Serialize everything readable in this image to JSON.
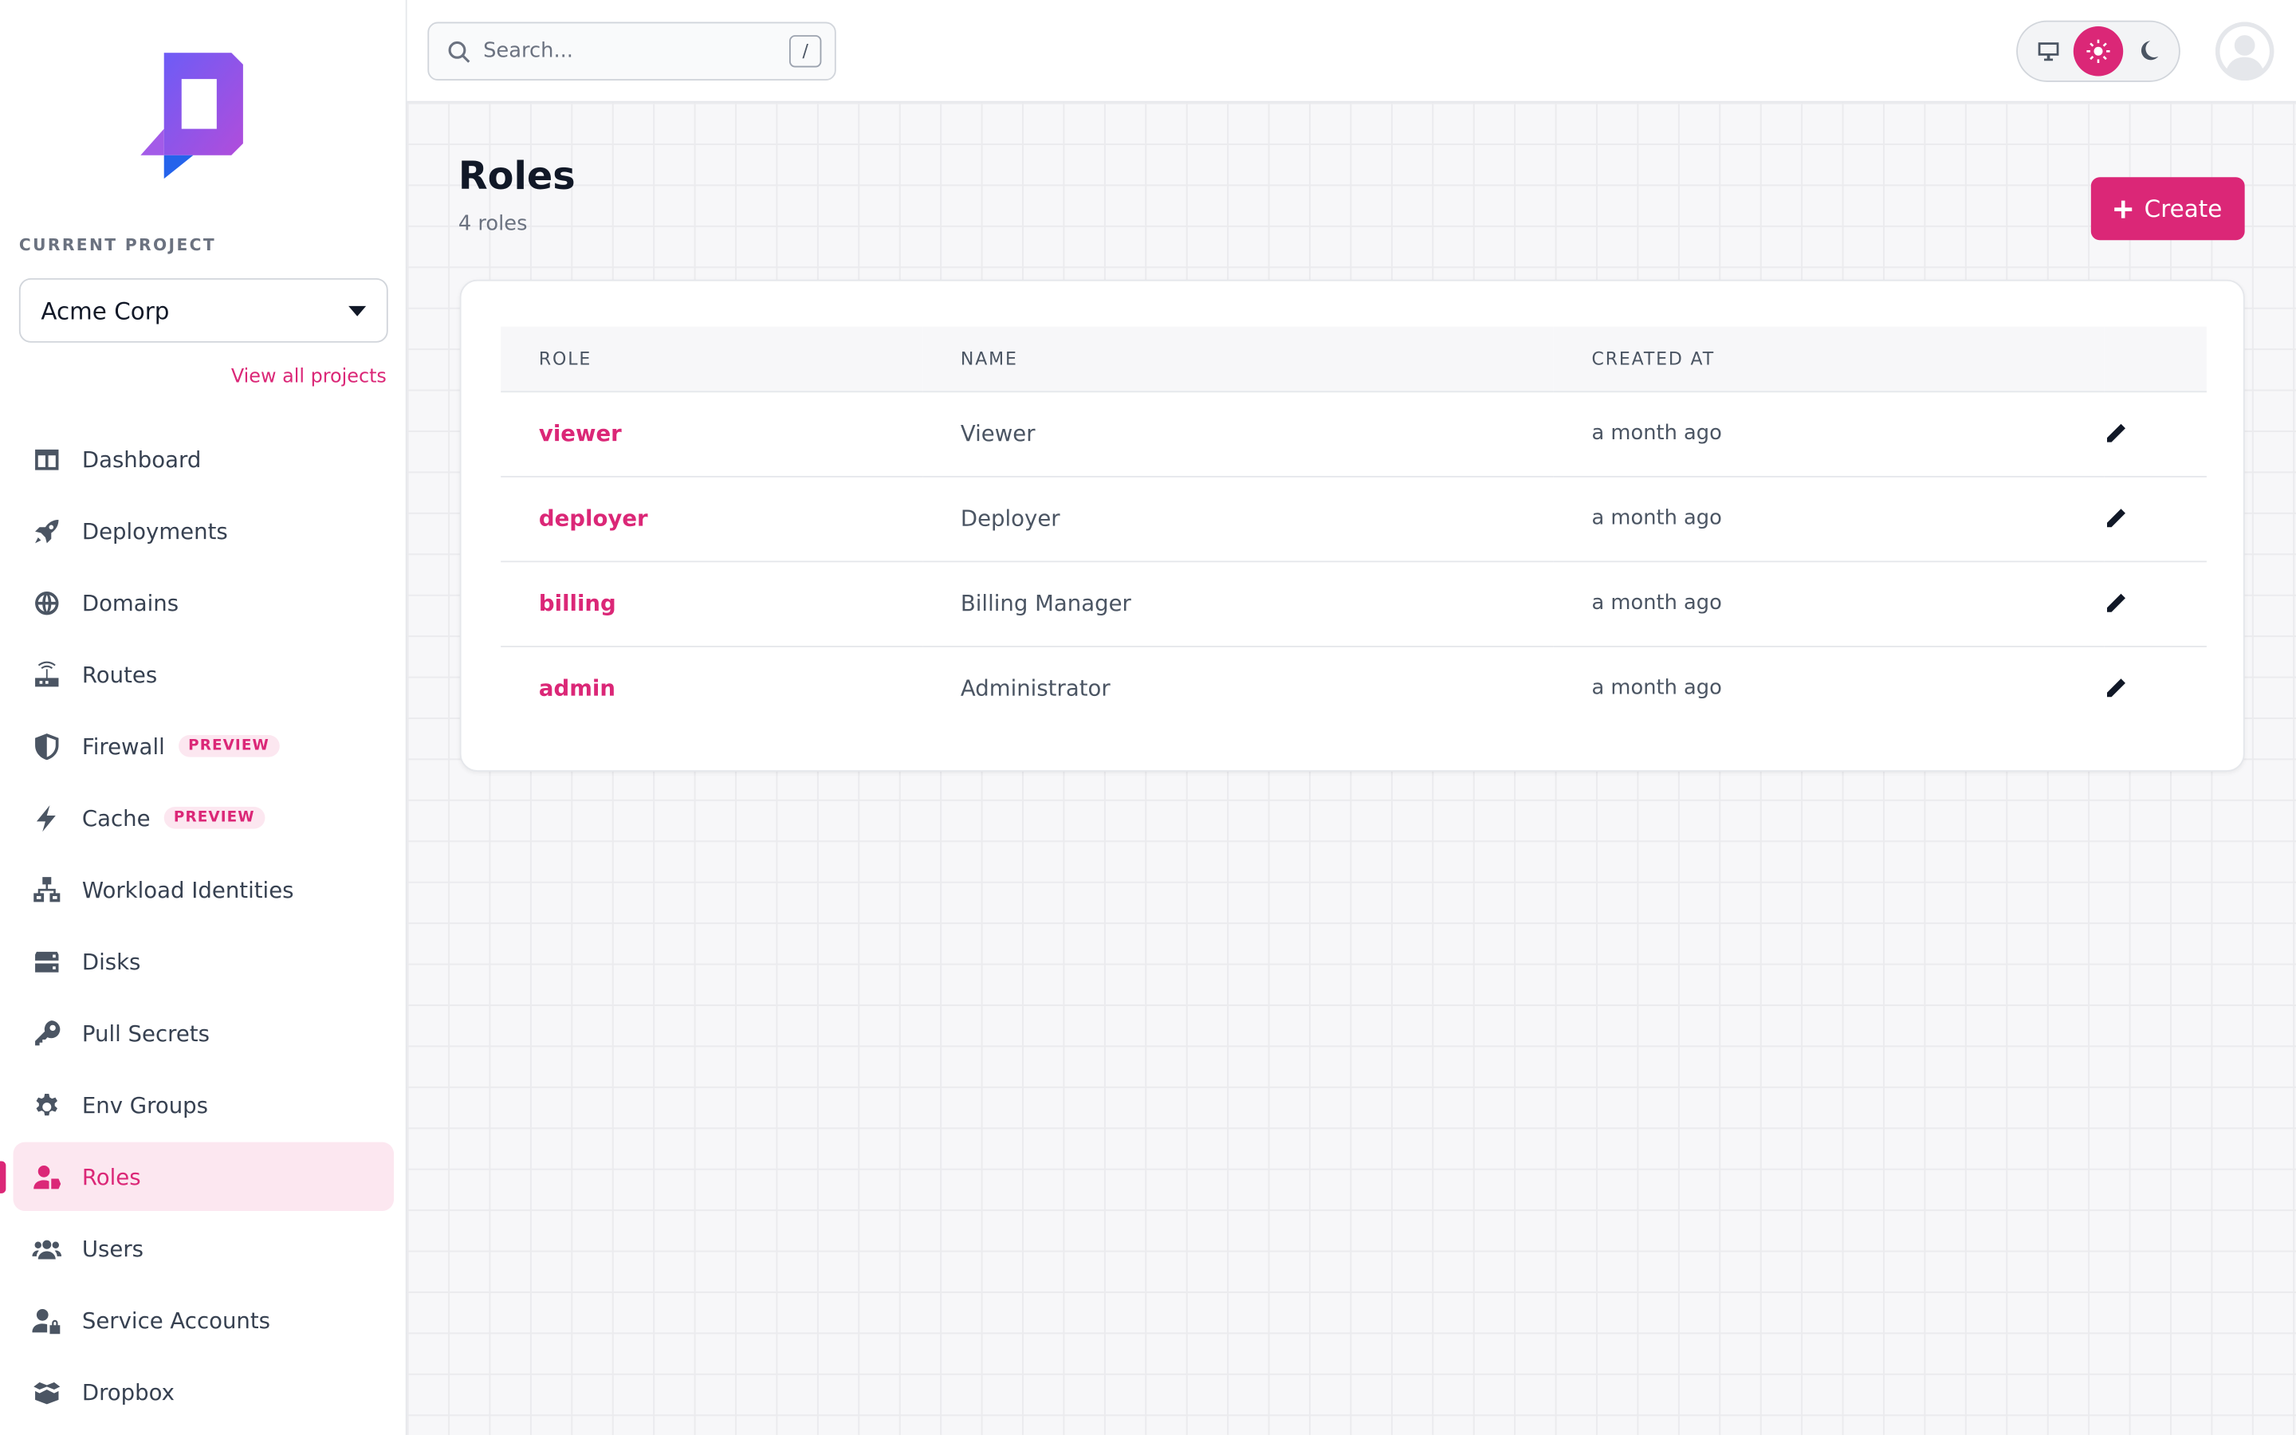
{
  "sidebar": {
    "project_label": "CURRENT PROJECT",
    "project_name": "Acme Corp",
    "view_all": "View all projects",
    "items": [
      {
        "label": "Dashboard",
        "icon": "dashboard-icon"
      },
      {
        "label": "Deployments",
        "icon": "rocket-icon"
      },
      {
        "label": "Domains",
        "icon": "globe-icon"
      },
      {
        "label": "Routes",
        "icon": "router-icon"
      },
      {
        "label": "Firewall",
        "icon": "shield-icon",
        "badge": "PREVIEW"
      },
      {
        "label": "Cache",
        "icon": "bolt-icon",
        "badge": "PREVIEW"
      },
      {
        "label": "Workload Identities",
        "icon": "network-icon"
      },
      {
        "label": "Disks",
        "icon": "disk-icon"
      },
      {
        "label": "Pull Secrets",
        "icon": "key-icon"
      },
      {
        "label": "Env Groups",
        "icon": "gear-icon"
      },
      {
        "label": "Roles",
        "icon": "user-tag-icon",
        "active": true
      },
      {
        "label": "Users",
        "icon": "users-icon"
      },
      {
        "label": "Service Accounts",
        "icon": "user-lock-icon"
      },
      {
        "label": "Dropbox",
        "icon": "box-icon"
      }
    ]
  },
  "topbar": {
    "search_placeholder": "Search...",
    "search_shortcut": "/",
    "theme_selected": "light"
  },
  "page": {
    "title": "Roles",
    "subtitle": "4 roles",
    "create_label": "Create"
  },
  "table": {
    "headers": [
      "ROLE",
      "NAME",
      "CREATED AT"
    ],
    "rows": [
      {
        "role": "viewer",
        "name": "Viewer",
        "created": "a month ago"
      },
      {
        "role": "deployer",
        "name": "Deployer",
        "created": "a month ago"
      },
      {
        "role": "billing",
        "name": "Billing Manager",
        "created": "a month ago"
      },
      {
        "role": "admin",
        "name": "Administrator",
        "created": "a month ago"
      }
    ]
  },
  "colors": {
    "accent": "#db2777",
    "accent_soft": "#fce7f0",
    "logo_gradient_start": "#6d5cf6",
    "logo_gradient_end": "#b14ddb",
    "logo_tail": "#2563eb"
  }
}
